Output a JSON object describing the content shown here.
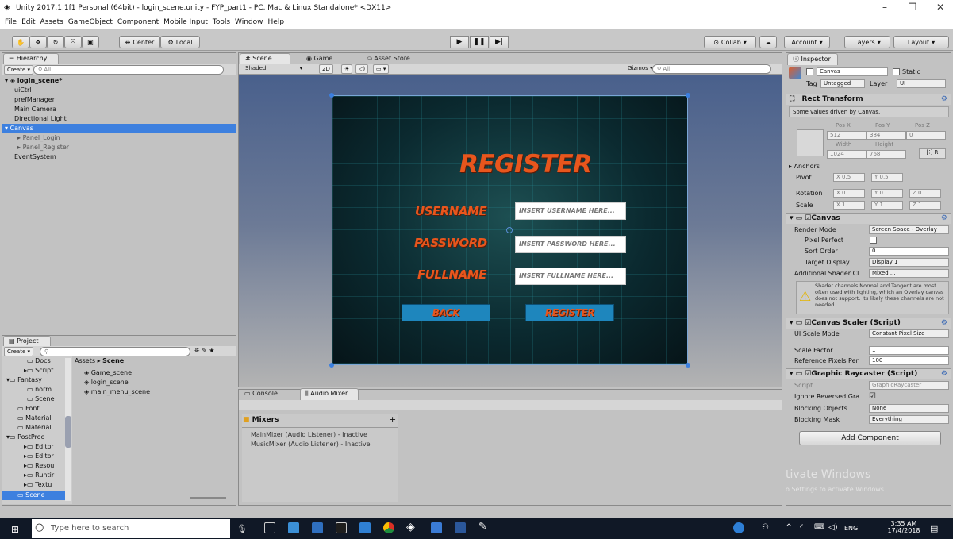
{
  "window": {
    "title": "Unity 2017.1.1f1 Personal (64bit) - login_scene.unity - FYP_part1 - PC, Mac & Linux Standalone* <DX11>"
  },
  "menu": [
    "File",
    "Edit",
    "Assets",
    "GameObject",
    "Component",
    "Mobile Input",
    "Tools",
    "Window",
    "Help"
  ],
  "toolbar": {
    "center": "Center",
    "local": "Local",
    "collab": "Collab",
    "account": "Account",
    "layers": "Layers",
    "layout": "Layout"
  },
  "hierarchy": {
    "tab": "Hierarchy",
    "create": "Create",
    "search": "All",
    "scene": "login_scene*",
    "items": [
      "uiCtrl",
      "prefManager",
      "Main Camera",
      "Directional Light",
      "Canvas",
      "Panel_Login",
      "Panel_Register",
      "EventSystem"
    ]
  },
  "scene": {
    "tabs": [
      "Scene",
      "Game",
      "Asset Store"
    ],
    "shaded": "Shaded",
    "mode2d": "2D",
    "gizmos": "Gizmos",
    "search": "All",
    "canvas": {
      "title": "REGISTER",
      "labels": [
        "USERNAME",
        "PASSWORD",
        "FULLNAME"
      ],
      "placeholders": [
        "INSERT USERNAME HERE...",
        "INSERT PASSWORD HERE...",
        "INSERT FULLNAME HERE..."
      ],
      "back": "BACK",
      "register": "REGISTER"
    }
  },
  "project": {
    "tab": "Project",
    "create": "Create",
    "folders": [
      "Docs",
      "Script",
      "Fantasy",
      "norm",
      "Scene",
      "Font",
      "Material",
      "Material",
      "PostProc",
      "Editor",
      "Editor",
      "Resou",
      "Runtir",
      "Textu",
      "Scene"
    ],
    "breadcrumb": [
      "Assets",
      "Scene"
    ],
    "assets": [
      "Game_scene",
      "login_scene",
      "main_menu_scene"
    ]
  },
  "console": {
    "tabs": [
      "Console",
      "Audio Mixer"
    ],
    "mixers_title": "Mixers",
    "mixers": [
      "MainMixer  (Audio Listener) - Inactive",
      "MusicMixer  (Audio Listener) - Inactive"
    ]
  },
  "inspector": {
    "tab": "Inspector",
    "object": "Canvas",
    "static": "Static",
    "tag_label": "Tag",
    "tag": "Untagged",
    "layer_label": "Layer",
    "layer": "UI",
    "rect": {
      "title": "Rect Transform",
      "note": "Some values driven by Canvas.",
      "posx_l": "Pos X",
      "posy_l": "Pos Y",
      "posz_l": "Pos Z",
      "posx": "512",
      "posy": "384",
      "posz": "0",
      "width_l": "Width",
      "height_l": "Height",
      "width": "1024",
      "height": "768",
      "anchors": "Anchors",
      "pivot": "Pivot",
      "pivx": "X 0.5",
      "pivy": "Y 0.5",
      "rotation": "Rotation",
      "rx": "X 0",
      "ry": "Y 0",
      "rz": "Z 0",
      "scale": "Scale",
      "sx": "X 1",
      "sy": "Y 1",
      "sz": "Z 1"
    },
    "canvas": {
      "title": "Canvas",
      "render_mode_l": "Render Mode",
      "render_mode": "Screen Space - Overlay",
      "pixel_perfect": "Pixel Perfect",
      "sort_order_l": "Sort Order",
      "sort_order": "0",
      "target_display_l": "Target Display",
      "target_display": "Display 1",
      "shader_l": "Additional Shader Cl",
      "shader": "Mixed ...",
      "warning": "Shader channels Normal and Tangent are most often used with lighting, which an Overlay canvas does not support. Its likely these channels are not needed."
    },
    "scaler": {
      "title": "Canvas Scaler (Script)",
      "ui_scale_l": "UI Scale Mode",
      "ui_scale": "Constant Pixel Size",
      "scale_factor_l": "Scale Factor",
      "scale_factor": "1",
      "ref_ppu_l": "Reference Pixels Per",
      "ref_ppu": "100"
    },
    "raycaster": {
      "title": "Graphic Raycaster (Script)",
      "script_l": "Script",
      "script": "GraphicRaycaster",
      "ignore_l": "Ignore Reversed Gra",
      "blocking_obj_l": "Blocking Objects",
      "blocking_obj": "None",
      "blocking_mask_l": "Blocking Mask",
      "blocking_mask": "Everything"
    },
    "add_component": "Add Component",
    "watermark": [
      "tivate Windows",
      "o Settings to activate Windows."
    ]
  },
  "taskbar": {
    "search": "Type here to search",
    "time": "3:35 AM",
    "date": "17/4/2018",
    "lang": "ENG"
  }
}
